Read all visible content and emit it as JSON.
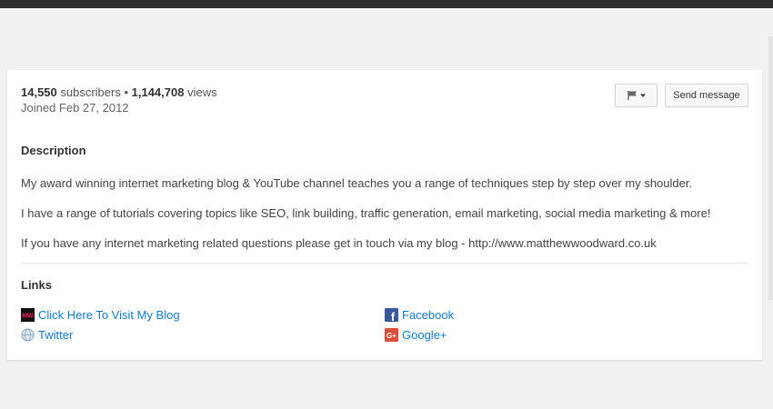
{
  "channel": {
    "subscriber_count": "14,550",
    "subscribers_word": " subscribers • ",
    "view_count": "1,144,708",
    "views_word": " views",
    "joined": "Joined Feb 27, 2012"
  },
  "actions": {
    "send_message_label": "Send message",
    "flag_icon": "flag-icon"
  },
  "description": {
    "heading": "Description",
    "paragraphs": [
      "My award winning internet marketing blog & YouTube channel teaches you a range of techniques step by step over my shoulder.",
      "I have a range of tutorials covering topics like SEO, link building, traffic generation, email marketing, social media marketing & more!",
      "If you have any internet marketing related questions please get in touch via my blog - http://www.matthewwoodward.co.uk"
    ]
  },
  "links": {
    "heading": "Links",
    "items": [
      {
        "label": "Click Here To Visit My Blog",
        "icon": "mw-blog-icon"
      },
      {
        "label": "Facebook",
        "icon": "facebook-icon"
      },
      {
        "label": "Twitter",
        "icon": "twitter-globe-icon"
      },
      {
        "label": "Google+",
        "icon": "google-plus-icon"
      }
    ]
  },
  "colors": {
    "link": "#167ac6",
    "facebook": "#3b5998",
    "google_plus": "#dd4b39",
    "topbar": "#2f2f2f"
  },
  "icon_text": {
    "mw": "MW",
    "f": "f",
    "gplus": "G+"
  }
}
